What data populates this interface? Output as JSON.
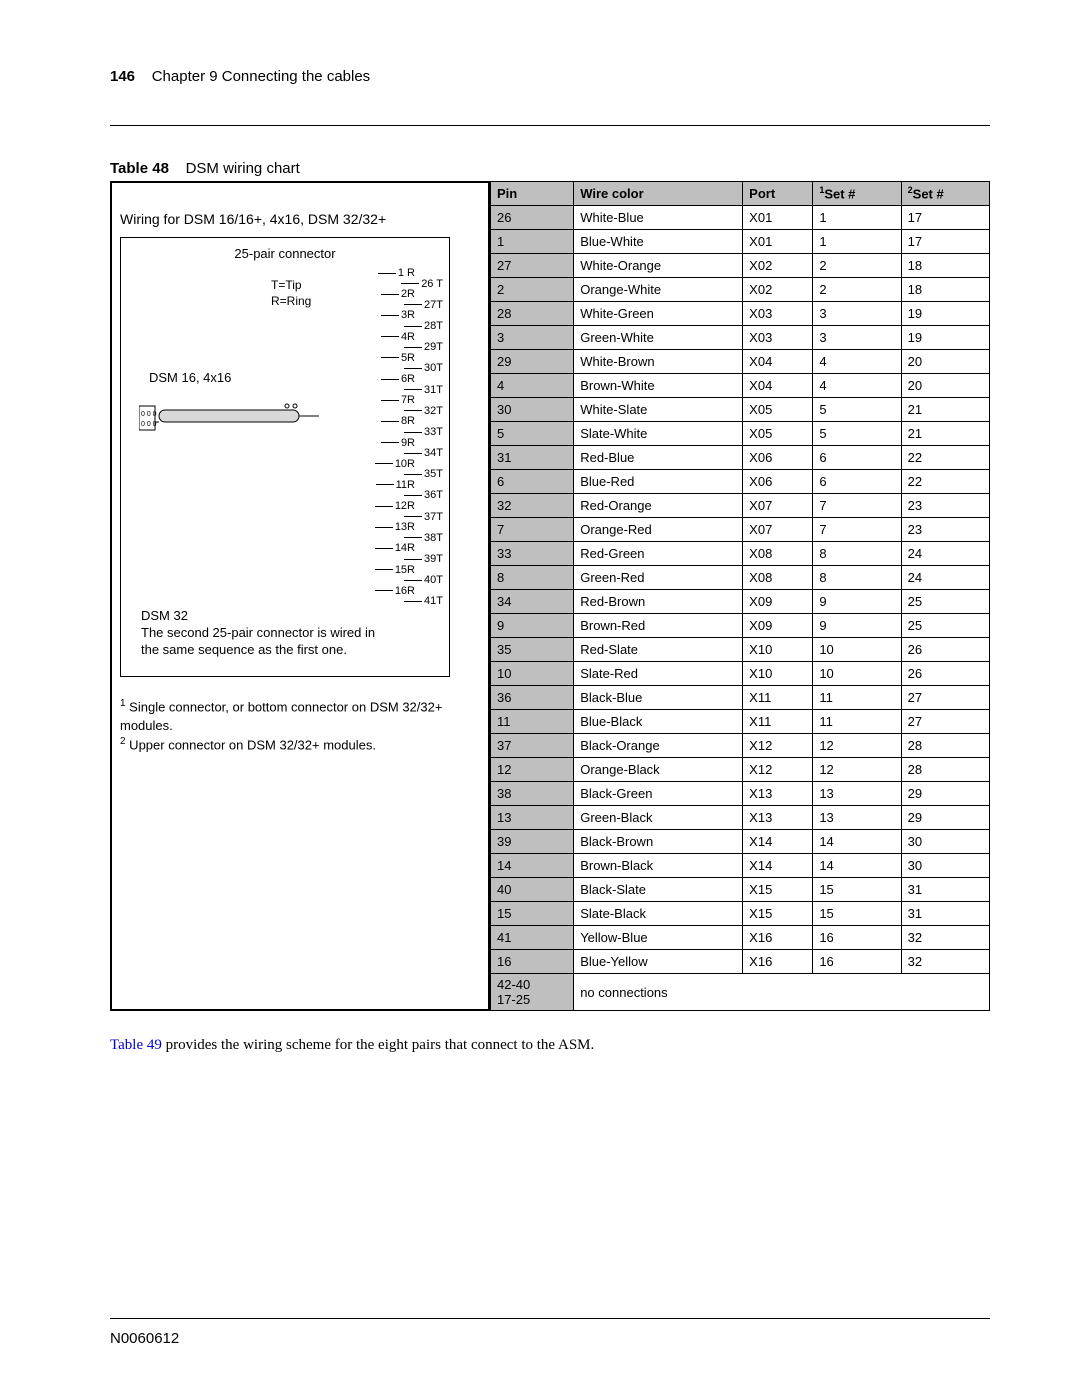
{
  "header": {
    "page_number": "146",
    "chapter": "Chapter 9  Connecting the cables"
  },
  "caption": {
    "label": "Table 48",
    "title": "DSM wiring chart"
  },
  "diagram": {
    "wiring_for": "Wiring for DSM 16/16+, 4x16, DSM 32/32+",
    "pair_connector": "25-pair connector",
    "tip": "T=Tip",
    "ring": "R=Ring",
    "dsm_label": "DSM 16, 4x16",
    "pairs": [
      "1 R",
      "26 T",
      "2R",
      "27T",
      "3R",
      "28T",
      "4R",
      "29T",
      "5R",
      "30T",
      "6R",
      "31T",
      "7R",
      "32T",
      "8R",
      "33T",
      "9R",
      "34T",
      "10R",
      "35T",
      "11R",
      "36T",
      "12R",
      "37T",
      "13R",
      "38T",
      "14R",
      "39T",
      "15R",
      "40T",
      "16R",
      "41T"
    ],
    "dsm32_title": "DSM 32",
    "dsm32_note": "The second 25-pair connector is wired in the same sequence as the first one."
  },
  "footnotes": {
    "note1": " Single connector, or bottom connector on DSM 32/32+ modules.",
    "note2": " Upper connector on DSM 32/32+ modules."
  },
  "table": {
    "headers": {
      "pin": "Pin",
      "wire": "Wire color",
      "port": "Port",
      "set1": "Set #",
      "set2": "Set #"
    },
    "rows": [
      {
        "pin": "26",
        "wire": "White-Blue",
        "port": "X01",
        "s1": "1",
        "s2": "17"
      },
      {
        "pin": "1",
        "wire": "Blue-White",
        "port": "X01",
        "s1": "1",
        "s2": "17"
      },
      {
        "pin": "27",
        "wire": "White-Orange",
        "port": "X02",
        "s1": "2",
        "s2": "18"
      },
      {
        "pin": "2",
        "wire": "Orange-White",
        "port": "X02",
        "s1": "2",
        "s2": "18"
      },
      {
        "pin": "28",
        "wire": "White-Green",
        "port": "X03",
        "s1": "3",
        "s2": "19"
      },
      {
        "pin": "3",
        "wire": "Green-White",
        "port": "X03",
        "s1": "3",
        "s2": "19"
      },
      {
        "pin": "29",
        "wire": "White-Brown",
        "port": "X04",
        "s1": "4",
        "s2": "20"
      },
      {
        "pin": "4",
        "wire": "Brown-White",
        "port": "X04",
        "s1": "4",
        "s2": "20"
      },
      {
        "pin": "30",
        "wire": "White-Slate",
        "port": "X05",
        "s1": "5",
        "s2": "21"
      },
      {
        "pin": "5",
        "wire": "Slate-White",
        "port": "X05",
        "s1": "5",
        "s2": "21"
      },
      {
        "pin": "31",
        "wire": "Red-Blue",
        "port": "X06",
        "s1": "6",
        "s2": "22"
      },
      {
        "pin": "6",
        "wire": "Blue-Red",
        "port": "X06",
        "s1": "6",
        "s2": "22"
      },
      {
        "pin": "32",
        "wire": "Red-Orange",
        "port": "X07",
        "s1": "7",
        "s2": "23"
      },
      {
        "pin": "7",
        "wire": "Orange-Red",
        "port": "X07",
        "s1": "7",
        "s2": "23"
      },
      {
        "pin": "33",
        "wire": "Red-Green",
        "port": "X08",
        "s1": "8",
        "s2": "24"
      },
      {
        "pin": "8",
        "wire": "Green-Red",
        "port": "X08",
        "s1": "8",
        "s2": "24"
      },
      {
        "pin": "34",
        "wire": "Red-Brown",
        "port": "X09",
        "s1": "9",
        "s2": "25"
      },
      {
        "pin": "9",
        "wire": "Brown-Red",
        "port": "X09",
        "s1": "9",
        "s2": "25"
      },
      {
        "pin": "35",
        "wire": "Red-Slate",
        "port": "X10",
        "s1": "10",
        "s2": "26"
      },
      {
        "pin": "10",
        "wire": "Slate-Red",
        "port": "X10",
        "s1": "10",
        "s2": "26"
      },
      {
        "pin": "36",
        "wire": "Black-Blue",
        "port": "X11",
        "s1": "11",
        "s2": "27"
      },
      {
        "pin": "11",
        "wire": "Blue-Black",
        "port": "X11",
        "s1": "11",
        "s2": "27"
      },
      {
        "pin": "37",
        "wire": "Black-Orange",
        "port": "X12",
        "s1": "12",
        "s2": "28"
      },
      {
        "pin": "12",
        "wire": "Orange-Black",
        "port": "X12",
        "s1": "12",
        "s2": "28"
      },
      {
        "pin": "38",
        "wire": "Black-Green",
        "port": "X13",
        "s1": "13",
        "s2": "29"
      },
      {
        "pin": "13",
        "wire": "Green-Black",
        "port": "X13",
        "s1": "13",
        "s2": "29"
      },
      {
        "pin": "39",
        "wire": "Black-Brown",
        "port": "X14",
        "s1": "14",
        "s2": "30"
      },
      {
        "pin": "14",
        "wire": "Brown-Black",
        "port": "X14",
        "s1": "14",
        "s2": "30"
      },
      {
        "pin": "40",
        "wire": "Black-Slate",
        "port": "X15",
        "s1": "15",
        "s2": "31"
      },
      {
        "pin": "15",
        "wire": "Slate-Black",
        "port": "X15",
        "s1": "15",
        "s2": "31"
      },
      {
        "pin": "41",
        "wire": "Yellow-Blue",
        "port": "X16",
        "s1": "16",
        "s2": "32"
      },
      {
        "pin": "16",
        "wire": "Blue-Yellow",
        "port": "X16",
        "s1": "16",
        "s2": "32"
      }
    ],
    "last": {
      "pin": "42-40\n17-25",
      "wire": "no connections"
    }
  },
  "body": {
    "link": "Table 49",
    "rest": " provides the wiring scheme for the eight pairs that connect to the ASM."
  },
  "footer": {
    "doc": "N0060612"
  }
}
